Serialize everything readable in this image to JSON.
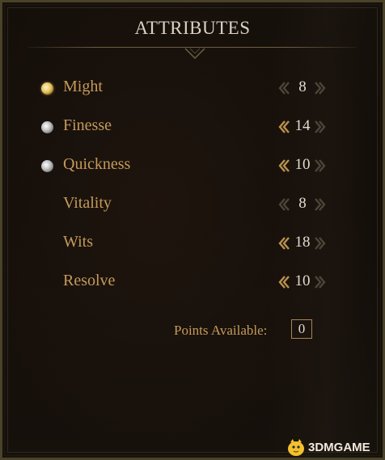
{
  "panel": {
    "title": "ATTRIBUTES"
  },
  "attributes": [
    {
      "name": "Might",
      "value": "8",
      "marker": "gold"
    },
    {
      "name": "Finesse",
      "value": "14",
      "marker": "silver"
    },
    {
      "name": "Quickness",
      "value": "10",
      "marker": "silver"
    },
    {
      "name": "Vitality",
      "value": "8",
      "marker": "none"
    },
    {
      "name": "Wits",
      "value": "18",
      "marker": "none"
    },
    {
      "name": "Resolve",
      "value": "10",
      "marker": "none"
    }
  ],
  "points": {
    "label": "Points Available:",
    "value": "0"
  },
  "watermark": {
    "text": "3DMGAME"
  },
  "colors": {
    "label": "#c59a5b",
    "value": "#e1dbcf",
    "arrow_active": "#b9914e",
    "arrow_inactive": "#4d4538",
    "gold_marker": "#e6c665",
    "silver_marker": "#c4c4c4"
  }
}
